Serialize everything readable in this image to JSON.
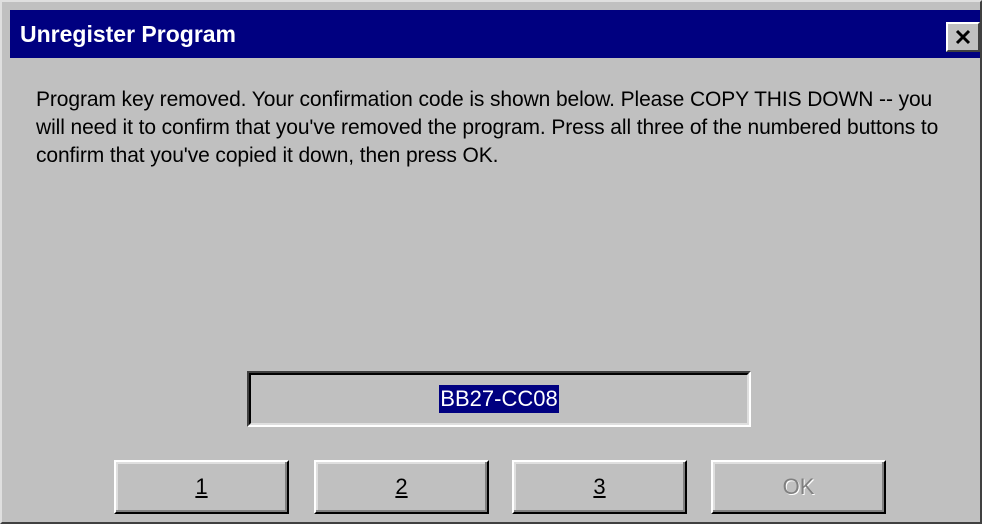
{
  "window": {
    "title": "Unregister Program"
  },
  "message": "Program key removed. Your confirmation code is shown below. Please COPY THIS DOWN -- you will need it to confirm that you've removed the program. Press all three of the numbered buttons to confirm that you've copied it down, then press OK.",
  "confirmation_code": "BB27-CC08",
  "buttons": {
    "one": "1",
    "two": "2",
    "three": "3",
    "ok": "OK"
  },
  "colors": {
    "titlebar": "#000080",
    "face": "#c0c0c0",
    "selection": "#000080"
  },
  "icons": {
    "close": "close-icon"
  }
}
